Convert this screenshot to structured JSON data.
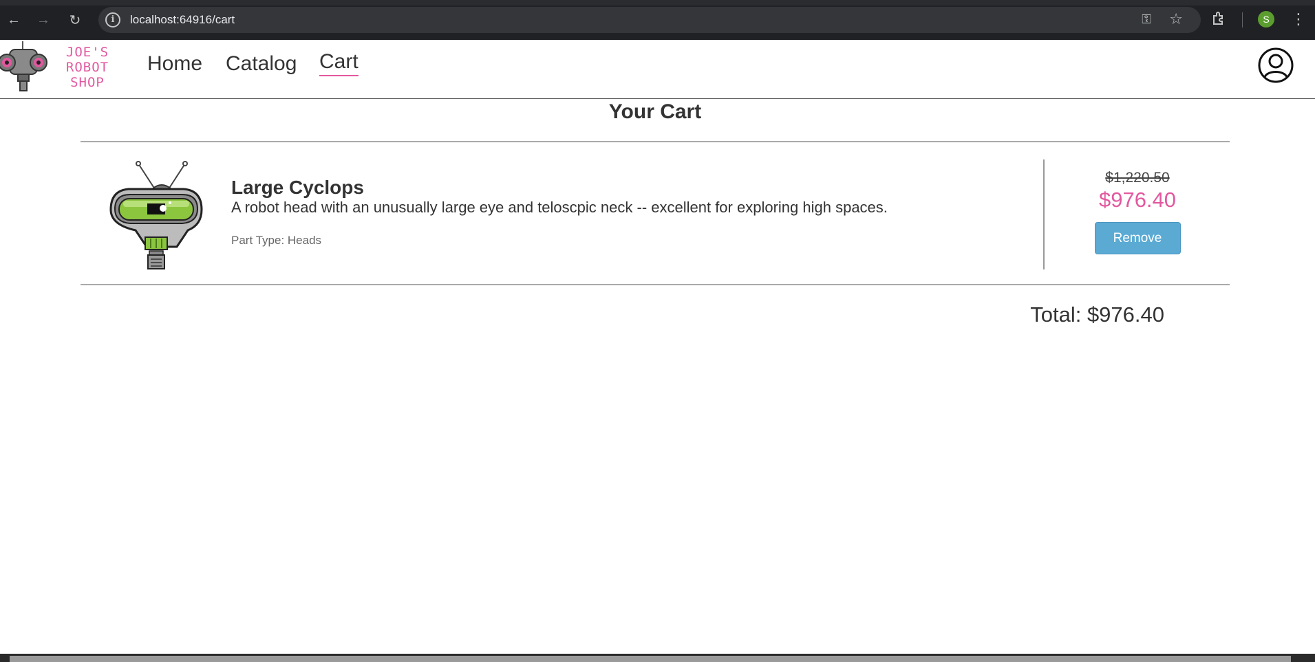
{
  "browser": {
    "url": "localhost:64916/cart",
    "profile_initial": "S"
  },
  "header": {
    "logo_lines": [
      "JOE'S",
      "ROBOT",
      "SHOP"
    ],
    "nav": {
      "home": "Home",
      "catalog": "Catalog",
      "cart": "Cart"
    }
  },
  "main": {
    "title": "Your Cart",
    "items": [
      {
        "name": "Large Cyclops",
        "description": "A robot head with an unusually large eye and teloscpic neck -- excellent for exploring high spaces.",
        "part_type": "Part Type: Heads",
        "original_price": "$1,220.50",
        "sale_price": "$976.40",
        "remove_label": "Remove"
      }
    ],
    "total": "Total: $976.40"
  },
  "colors": {
    "accent_pink": "#e2589f",
    "button_blue": "#5aaad4",
    "robot_green": "#8cc63f"
  }
}
